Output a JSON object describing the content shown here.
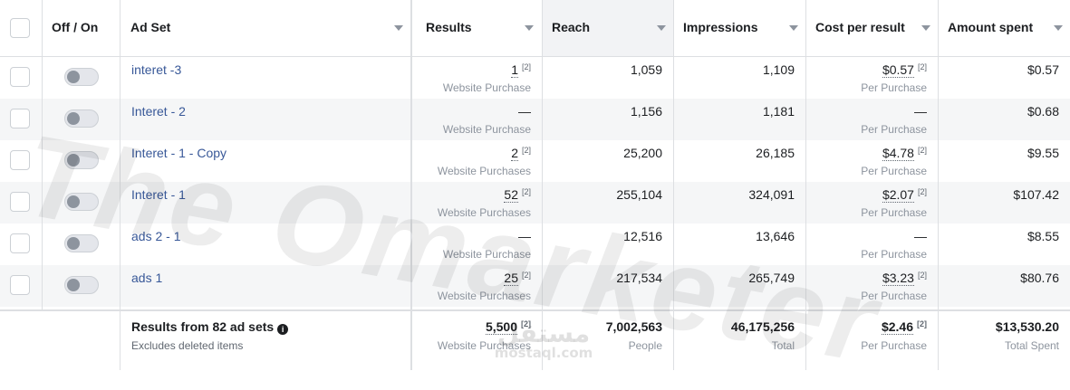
{
  "columns": {
    "toggle": "Off / On",
    "ad_set": "Ad Set",
    "results": "Results",
    "reach": "Reach",
    "impressions": "Impressions",
    "cost": "Cost per result",
    "amount": "Amount spent"
  },
  "rows": [
    {
      "name": "interet -3",
      "results": "1",
      "results_sup": "[2]",
      "results_sub": "Website Purchase",
      "reach": "1,059",
      "impressions": "1,109",
      "cost": "$0.57",
      "cost_sup": "[2]",
      "cost_sub": "Per Purchase",
      "amount": "$0.57"
    },
    {
      "name": "Interet - 2",
      "results": "—",
      "results_sup": "",
      "results_sub": "Website Purchase",
      "reach": "1,156",
      "impressions": "1,181",
      "cost": "—",
      "cost_sup": "",
      "cost_sub": "Per Purchase",
      "amount": "$0.68"
    },
    {
      "name": "Interet - 1 - Copy",
      "results": "2",
      "results_sup": "[2]",
      "results_sub": "Website Purchases",
      "reach": "25,200",
      "impressions": "26,185",
      "cost": "$4.78",
      "cost_sup": "[2]",
      "cost_sub": "Per Purchase",
      "amount": "$9.55"
    },
    {
      "name": "Interet - 1",
      "results": "52",
      "results_sup": "[2]",
      "results_sub": "Website Purchases",
      "reach": "255,104",
      "impressions": "324,091",
      "cost": "$2.07",
      "cost_sup": "[2]",
      "cost_sub": "Per Purchase",
      "amount": "$107.42"
    },
    {
      "name": "ads 2 - 1",
      "results": "—",
      "results_sup": "",
      "results_sub": "Website Purchase",
      "reach": "12,516",
      "impressions": "13,646",
      "cost": "—",
      "cost_sup": "",
      "cost_sub": "Per Purchase",
      "amount": "$8.55"
    },
    {
      "name": "ads 1",
      "results": "25",
      "results_sup": "[2]",
      "results_sub": "Website Purchases",
      "reach": "217,534",
      "impressions": "265,749",
      "cost": "$3.23",
      "cost_sup": "[2]",
      "cost_sub": "Per Purchase",
      "amount": "$80.76"
    }
  ],
  "footer": {
    "title": "Results from 82 ad sets",
    "subtitle": "Excludes deleted items",
    "results": "5,500",
    "results_sup": "[2]",
    "results_sub": "Website Purchases",
    "reach": "7,002,563",
    "reach_sub": "People",
    "impressions": "46,175,256",
    "impressions_sub": "Total",
    "cost": "$2.46",
    "cost_sup": "[2]",
    "cost_sub": "Per Purchase",
    "amount": "$13,530.20",
    "amount_sub": "Total Spent"
  },
  "watermark": {
    "main": "The Omarketer",
    "arabic": "مستقل",
    "latin": "mostaql.com"
  },
  "icons": {
    "info": "info-icon",
    "sort": "caret-down-icon"
  }
}
